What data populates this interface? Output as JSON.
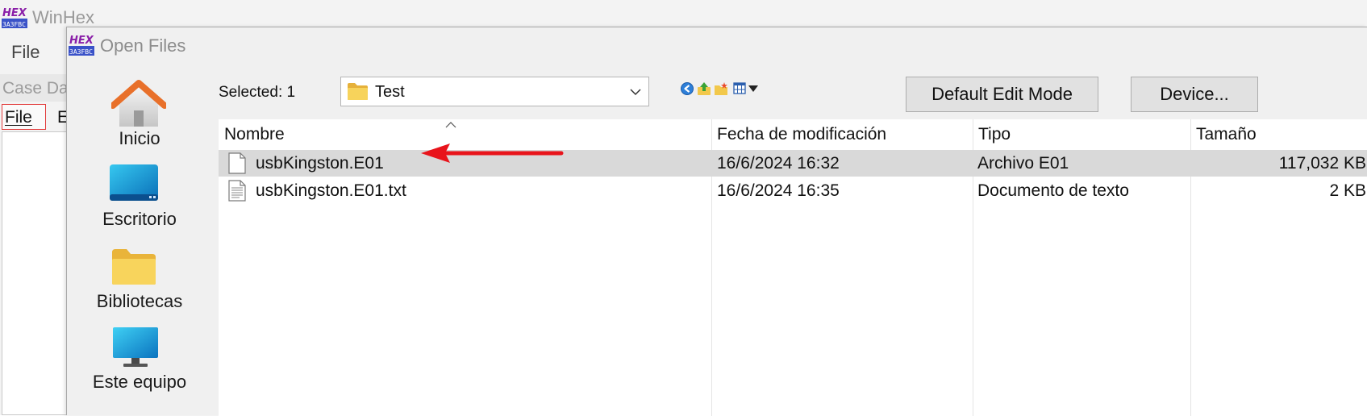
{
  "background_app": {
    "title": "WinHex",
    "menu_file": "File",
    "case_label": "Case Da",
    "tab_file": "File",
    "tab_e": "E"
  },
  "dialog": {
    "title": "Open Files",
    "selected_label": "Selected: 1",
    "folder": "Test",
    "buttons": {
      "default_edit_mode": "Default Edit Mode",
      "device": "Device..."
    },
    "places": [
      {
        "label": "Inicio",
        "icon": "home-icon"
      },
      {
        "label": "Escritorio",
        "icon": "desktop-icon"
      },
      {
        "label": "Bibliotecas",
        "icon": "libraries-folder-icon"
      },
      {
        "label": "Este equipo",
        "icon": "this-pc-icon"
      }
    ],
    "toolbar_icons": [
      "back-icon",
      "up-folder-icon",
      "new-folder-icon",
      "view-menu-icon"
    ],
    "columns": {
      "name": "Nombre",
      "date": "Fecha de modificación",
      "type": "Tipo",
      "size": "Tamaño"
    },
    "files": [
      {
        "name": "usbKingston.E01",
        "date": "16/6/2024 16:32",
        "type": "Archivo E01",
        "size": "117,032 KB",
        "selected": true
      },
      {
        "name": "usbKingston.E01.txt",
        "date": "16/6/2024 16:35",
        "type": "Documento de texto",
        "size": "2 KB",
        "selected": false
      }
    ]
  },
  "colors": {
    "selection": "#d9d9d9",
    "annotation_arrow": "#e8141b",
    "home_roof": "#e8702a",
    "folder": "#f6c945"
  }
}
